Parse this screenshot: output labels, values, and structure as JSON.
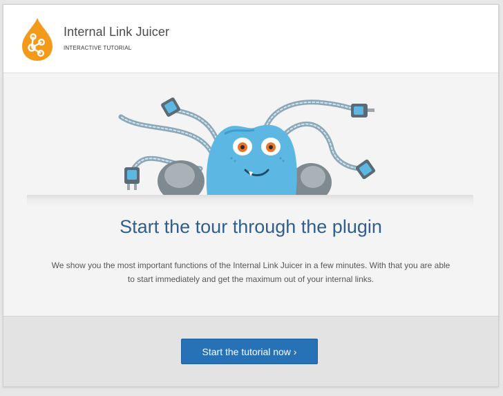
{
  "header": {
    "title": "Internal Link Juicer",
    "subtitle": "INTERACTIVE TUTORIAL",
    "logo_icon": "link-juice-drop-icon"
  },
  "main": {
    "illustration_icon": "cable-monster-mascot-icon",
    "title": "Start the tour through the plugin",
    "description": "We show you the most important functions of the Internal Link Juicer in a few minutes. With that you are able to start immediately and get the maximum out of your internal links."
  },
  "footer": {
    "start_button_label": "Start the tutorial now ›"
  },
  "colors": {
    "brand_orange": "#f39a1b",
    "title_blue": "#2f5f8f",
    "button_blue": "#2771b6",
    "mascot_blue": "#5cb8e2"
  }
}
